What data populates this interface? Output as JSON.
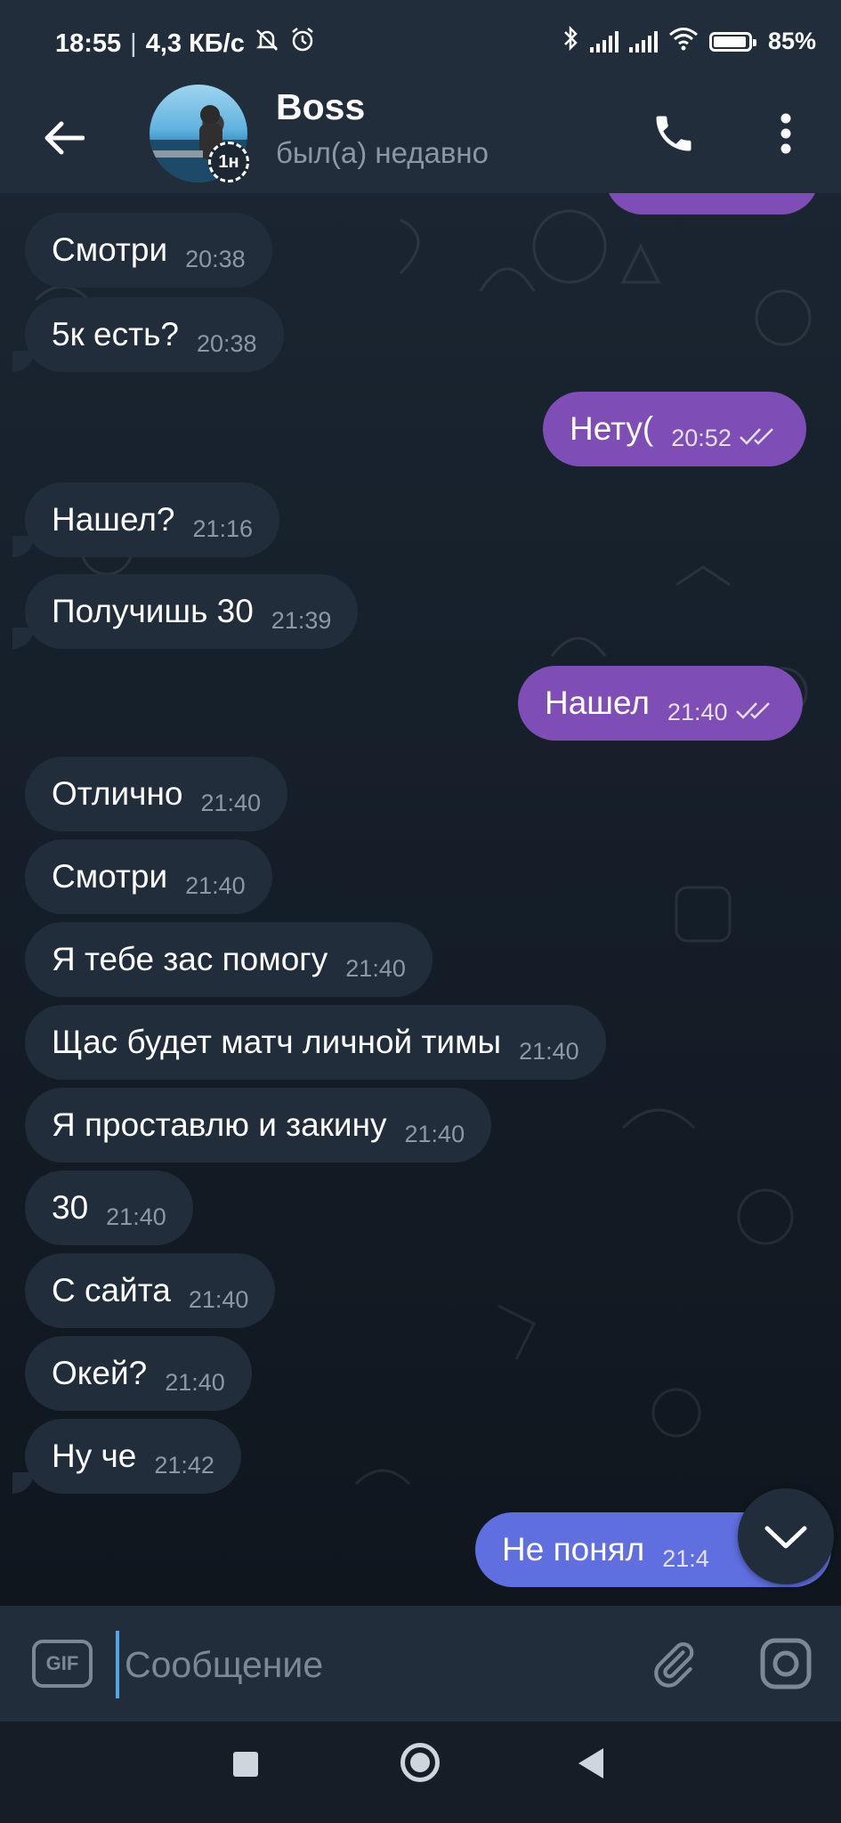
{
  "status_bar": {
    "time": "18:55",
    "speed": "4,3 КБ/с",
    "battery_pct": "85%",
    "battery_level": 0.85
  },
  "header": {
    "title": "Boss",
    "status": "был(а) недавно",
    "story_badge": "1н"
  },
  "messages": [
    {
      "dir": "in",
      "text": "Смотри",
      "time": "20:38"
    },
    {
      "dir": "in",
      "text": "5к есть?",
      "time": "20:38"
    },
    {
      "dir": "out",
      "text": "Нету(",
      "time": "20:52",
      "read": true
    },
    {
      "dir": "in",
      "text": "Нашел?",
      "time": "21:16"
    },
    {
      "dir": "in",
      "text": "Получишь 30",
      "time": "21:39"
    },
    {
      "dir": "out",
      "text": "Нашел",
      "time": "21:40",
      "read": true
    },
    {
      "dir": "in",
      "text": "Отлично",
      "time": "21:40"
    },
    {
      "dir": "in",
      "text": "Смотри",
      "time": "21:40"
    },
    {
      "dir": "in",
      "text": "Я тебе зас помогу",
      "time": "21:40"
    },
    {
      "dir": "in",
      "text": "Щас будет матч личной тимы",
      "time": "21:40"
    },
    {
      "dir": "in",
      "text": "Я проставлю и закину",
      "time": "21:40"
    },
    {
      "dir": "in",
      "text": "30",
      "time": "21:40"
    },
    {
      "dir": "in",
      "text": "С сайта",
      "time": "21:40"
    },
    {
      "dir": "in",
      "text": "Окей?",
      "time": "21:40"
    },
    {
      "dir": "in",
      "text": "Ну че",
      "time": "21:42"
    },
    {
      "dir": "out",
      "text": "Не понял",
      "time": "21:4"
    }
  ],
  "input": {
    "placeholder": "Сообщение",
    "gif_label": "GIF"
  },
  "colors": {
    "incoming_bubble": "#212d3b",
    "outgoing_bubble": "#7e4db6",
    "outgoing_bubble_latest": "#5f6fe0",
    "header_bg": "#212d3b",
    "chat_bg": "#16202c"
  },
  "icons": [
    "back-arrow-icon",
    "phone-icon",
    "more-vertical-icon",
    "chevron-down-icon",
    "gif-icon",
    "paperclip-icon",
    "camera-icon",
    "bluetooth-icon",
    "wifi-icon",
    "alarm-icon",
    "mute-icon"
  ]
}
